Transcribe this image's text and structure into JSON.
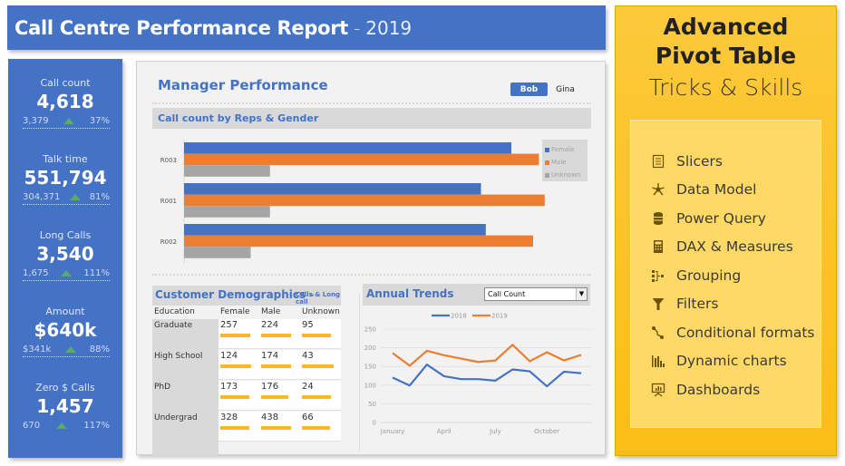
{
  "header": {
    "title": "Call Centre Performance Report",
    "separator": "-",
    "year": "2019"
  },
  "kpis": [
    {
      "label": "Call count",
      "value": "4,618",
      "previous": "3,379",
      "trend": "up",
      "change": "37%"
    },
    {
      "label": "Talk time",
      "value": "551,794",
      "previous": "304,371",
      "trend": "up",
      "change": "81%"
    },
    {
      "label": "Long Calls",
      "value": "3,540",
      "previous": "1,675",
      "trend": "up",
      "change": "111%"
    },
    {
      "label": "Amount",
      "value": "$640k",
      "previous": "$341k",
      "trend": "up",
      "change": "88%"
    },
    {
      "label": "Zero $ Calls",
      "value": "1,457",
      "previous": "670",
      "trend": "up",
      "change": "117%"
    }
  ],
  "manager": {
    "title": "Manager Performance",
    "slicer": [
      {
        "label": "Bob",
        "selected": true
      },
      {
        "label": "Gina",
        "selected": false
      }
    ],
    "section_title": "Call count by Reps & Gender"
  },
  "demographics": {
    "title": "Customer Demographics",
    "separator": "-",
    "subtitle": "Calls & Long call",
    "columns": [
      "Education",
      "Female",
      "Male",
      "Unknown"
    ],
    "rows": [
      {
        "label": "Graduate",
        "values": [
          "257",
          "224",
          "95"
        ],
        "bar_fraction": [
          0.92,
          0.92,
          0.88
        ]
      },
      {
        "label": "High School",
        "values": [
          "124",
          "174",
          "43"
        ],
        "bar_fraction": [
          0.94,
          0.92,
          0.97
        ]
      },
      {
        "label": "PhD",
        "values": [
          "173",
          "176",
          "24"
        ],
        "bar_fraction": [
          0.88,
          0.84,
          0.89
        ]
      },
      {
        "label": "Undergrad",
        "values": [
          "328",
          "438",
          "66"
        ],
        "bar_fraction": [
          0.9,
          0.92,
          0.87
        ]
      }
    ]
  },
  "trends": {
    "title": "Annual Trends",
    "dropdown_value": "Call Count",
    "dropdown_arrow": "▼"
  },
  "promo": {
    "line1": "Advanced",
    "line2": "Pivot Table",
    "line3": "Tricks & Skills",
    "items": [
      {
        "icon": "slicer-icon",
        "label": "Slicers"
      },
      {
        "icon": "data-model-icon",
        "label": "Data Model"
      },
      {
        "icon": "database-icon",
        "label": "Power Query"
      },
      {
        "icon": "calculator-icon",
        "label": "DAX & Measures"
      },
      {
        "icon": "grouping-icon",
        "label": "Grouping"
      },
      {
        "icon": "filter-icon",
        "label": "Filters"
      },
      {
        "icon": "conditional-format-icon",
        "label": "Conditional formats"
      },
      {
        "icon": "bar-chart-icon",
        "label": "Dynamic charts"
      },
      {
        "icon": "dashboard-icon",
        "label": "Dashboards"
      }
    ]
  },
  "colors": {
    "blue": "#4472c4",
    "orange": "#ed7d31",
    "gray": "#a5a5a5",
    "gold": "#ffb627",
    "green": "#5aa878"
  },
  "chart_data": [
    {
      "type": "bar",
      "orientation": "horizontal",
      "title": "Call count by Reps & Gender",
      "categories": [
        "R003",
        "R001",
        "R002"
      ],
      "series": [
        {
          "name": "Female",
          "color": "#4472c4",
          "values": [
            678,
            615,
            625
          ]
        },
        {
          "name": "Male",
          "color": "#ed7d31",
          "values": [
            735,
            747,
            723
          ]
        },
        {
          "name": "Unknown",
          "color": "#a5a5a5",
          "values": [
            178,
            178,
            138
          ]
        }
      ],
      "xlim": [
        0,
        800
      ],
      "axis_visible": false,
      "legend": "right"
    },
    {
      "type": "line",
      "title": "Annual Trends",
      "x": [
        "January",
        "February",
        "March",
        "April",
        "May",
        "June",
        "July",
        "August",
        "September",
        "October",
        "November",
        "December"
      ],
      "x_tick_labels": [
        "January",
        "April",
        "July",
        "October"
      ],
      "series": [
        {
          "name": "2018",
          "color": "#4472c4",
          "values": [
            120,
            99,
            155,
            124,
            116,
            116,
            112,
            142,
            137,
            97,
            136,
            132
          ]
        },
        {
          "name": "2019",
          "color": "#ed7d31",
          "values": [
            186,
            152,
            192,
            180,
            171,
            162,
            166,
            208,
            164,
            188,
            166,
            181
          ]
        }
      ],
      "ylim": [
        0,
        250
      ],
      "y_ticks": [
        0,
        50,
        100,
        150,
        200,
        250
      ],
      "grid": true,
      "legend": "top"
    }
  ]
}
